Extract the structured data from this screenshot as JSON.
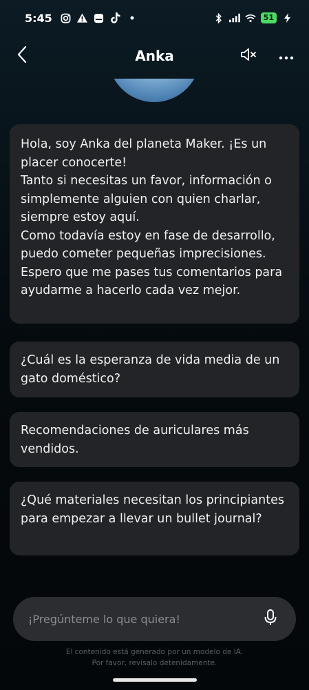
{
  "status_bar": {
    "time": "5:45",
    "battery": "51",
    "icons": [
      "instagram-icon",
      "warning-icon",
      "message-icon",
      "tiktok-icon",
      "dot-icon",
      "bluetooth-icon",
      "signal-icon",
      "wifi-icon",
      "charging-icon"
    ]
  },
  "header": {
    "title": "Anka",
    "back_icon": "chevron-left-icon",
    "mute_icon": "speaker-muted-icon",
    "more_icon": "more-horizontal-icon"
  },
  "chat": {
    "intro_message": "Hola, soy Anka del planeta Maker. ¡Es un placer conocerte!\nTanto si necesitas un favor, información o simplemente alguien con quien charlar, siempre estoy aquí.\nComo todavía estoy en fase de desarrollo, puedo cometer pequeñas imprecisiones. Espero que me pases tus comentarios para ayudarme a hacerlo cada vez mejor.",
    "suggestions": [
      "¿Cuál es la esperanza de vida media de un gato doméstico?",
      "Recomendaciones de auriculares más vendidos.",
      "¿Qué materiales necesitan los principiantes para empezar a llevar un bullet journal?"
    ]
  },
  "input": {
    "placeholder": "¡Pregúnteme lo que quiera!",
    "value": "",
    "mic_icon": "microphone-icon"
  },
  "footer": {
    "disclaimer_line1": "El contenido está generado por un modelo de IA.",
    "disclaimer_line2": "Por favor, revísalo detenidamente."
  },
  "colors": {
    "bubble": "#232427",
    "input_bg": "#2c2d31",
    "battery": "#4cd964"
  }
}
